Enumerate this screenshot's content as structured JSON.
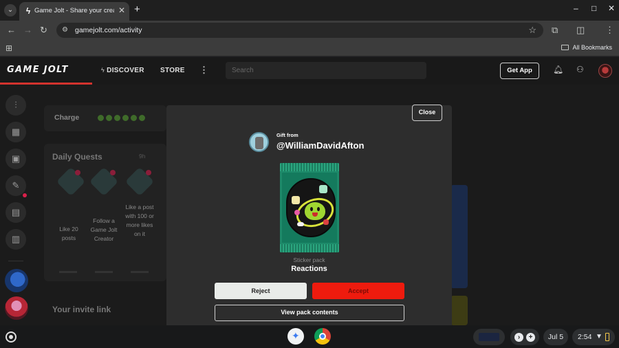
{
  "browser": {
    "tab_title": "Game Jolt - Share your creations",
    "new_tab": "+",
    "url": "gamejolt.com/activity",
    "bookmarks_label": "All Bookmarks",
    "window_controls": [
      "–",
      "□",
      "✕"
    ]
  },
  "site_header": {
    "logo": "GAME JOLT",
    "nav": [
      "DISCOVER",
      "STORE"
    ],
    "more": "⋮",
    "search_placeholder": "Search",
    "get_app": "Get App"
  },
  "left_column": {
    "charge_label": "Charge",
    "daily_quests_title": "Daily Quests",
    "daily_quests_time": "9h",
    "quests": [
      {
        "text": "Like 20 posts"
      },
      {
        "text": "Follow a Game Jolt Creator"
      },
      {
        "text": "Like a post with 100 or more likes on it"
      }
    ],
    "invite_title": "Your invite link"
  },
  "modal": {
    "close_label": "Close",
    "gift_from_label": "Gift from",
    "username": "@WilliamDavidAfton",
    "pack_kind": "Sticker pack",
    "pack_name": "Reactions",
    "reject_label": "Reject",
    "accept_label": "Accept",
    "view_label": "View pack contents"
  },
  "shelf": {
    "date": "Jul 5",
    "time": "2:54"
  },
  "colors": {
    "accent_red": "#ee1b0e",
    "logo_underline": "#d3332e",
    "modal_bg": "#2d2d2d",
    "pack_green": "#1d8a6a"
  },
  "icons": [
    "chevron-down-icon",
    "gamejolt-favicon-icon",
    "close-icon",
    "back-arrow-icon",
    "forward-arrow-icon",
    "reload-icon",
    "site-settings-icon",
    "star-icon",
    "extensions-icon",
    "reading-list-icon",
    "menu-dots-icon",
    "apps-grid-icon",
    "folder-icon",
    "bolt-icon",
    "bell-icon",
    "friends-icon",
    "launcher-icon",
    "gemini-icon",
    "chrome-icon",
    "wifi-icon",
    "battery-icon"
  ]
}
